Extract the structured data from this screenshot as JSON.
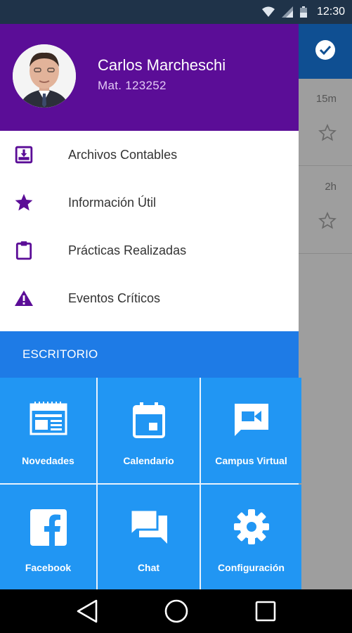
{
  "status_bar": {
    "time": "12:30",
    "icons": [
      "wifi-icon",
      "signal-icon",
      "battery-icon"
    ]
  },
  "drawer": {
    "user": {
      "name": "Carlos Marcheschi",
      "mat": "Mat. 123252",
      "avatar": "avatar-photo"
    },
    "menu_items": [
      {
        "label": "Archivos Contables",
        "icon": "archive-icon"
      },
      {
        "label": "Información Útil",
        "icon": "star-icon"
      },
      {
        "label": "Prácticas Realizadas",
        "icon": "clipboard-icon"
      },
      {
        "label": "Eventos Críticos",
        "icon": "warning-icon"
      }
    ],
    "section_label": "ESCRITORIO",
    "tiles": [
      {
        "label": "Novedades",
        "icon": "news-icon"
      },
      {
        "label": "Calendario",
        "icon": "calendar-icon"
      },
      {
        "label": "Campus Virtual",
        "icon": "video-chat-icon"
      },
      {
        "label": "Facebook",
        "icon": "facebook-icon"
      },
      {
        "label": "Chat",
        "icon": "chat-icon"
      },
      {
        "label": "Configuración",
        "icon": "gear-icon"
      }
    ]
  },
  "background_app": {
    "rows": [
      {
        "time": "15m"
      },
      {
        "time": "2h"
      }
    ]
  },
  "colors": {
    "header": "#5b0d97",
    "section": "#1e7be6",
    "tile": "#2196f3",
    "menu_icon": "#5b0d97"
  }
}
